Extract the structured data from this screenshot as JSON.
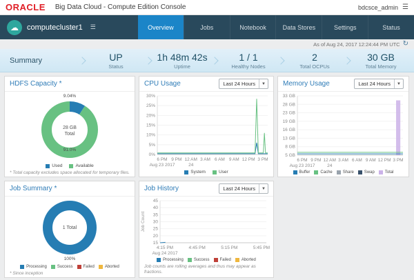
{
  "header": {
    "brand": "ORACLE",
    "title": "Big Data Cloud - Compute Edition Console",
    "user": "bdcsce_admin"
  },
  "cluster": {
    "name": "computecluster1"
  },
  "tabs": [
    {
      "label": "Overview",
      "active": true
    },
    {
      "label": "Jobs",
      "active": false
    },
    {
      "label": "Notebook",
      "active": false
    },
    {
      "label": "Data Stores",
      "active": false
    },
    {
      "label": "Settings",
      "active": false
    },
    {
      "label": "Status",
      "active": false
    }
  ],
  "asof": "As of Aug 24, 2017 12:24:44 PM UTC",
  "summary": {
    "label": "Summary",
    "metrics": [
      {
        "value": "UP",
        "label": "Status"
      },
      {
        "value": "1h 48m 42s",
        "label": "Uptime"
      },
      {
        "value": "1 / 1",
        "label": "Healthy Nodes"
      },
      {
        "value": "2",
        "label": "Total OCPUs"
      },
      {
        "value": "30 GB",
        "label": "Total Memory"
      }
    ]
  },
  "cards": {
    "hdfs": {
      "title": "HDFS Capacity *",
      "donut": {
        "slices": [
          {
            "name": "Used",
            "pct": 9.04,
            "color": "#267db3"
          },
          {
            "name": "Available",
            "pct": 90.96,
            "color": "#68c182"
          }
        ],
        "label_top": "9.04%",
        "label_bottom": "91.0%",
        "center_line1": "28 GB",
        "center_line2": "Total"
      },
      "legend": [
        {
          "label": "Used",
          "color": "#267db3"
        },
        {
          "label": "Available",
          "color": "#68c182"
        }
      ],
      "footnote": "* Total capacity excludes space allocated for temporary files."
    },
    "cpu": {
      "title": "CPU Usage",
      "range": "Last 24 Hours",
      "chart": {
        "type": "line",
        "ymax": 30,
        "yticks": [
          "30%",
          "25%",
          "20%",
          "15%",
          "10%",
          "5%",
          "0%"
        ],
        "xticks": [
          "6 PM",
          "9 PM",
          "12 AM",
          "3 AM",
          "6 AM",
          "9 AM",
          "12 PM",
          "3 PM"
        ],
        "xsub": [
          {
            "text": "Aug 23 2017",
            "at": 0
          },
          {
            "text": "24",
            "at": 2
          }
        ],
        "series": [
          {
            "name": "System",
            "color": "#267db3",
            "points": [
              [
                0,
                0.4
              ],
              [
                0.885,
                0.4
              ],
              [
                0.9,
                6
              ],
              [
                0.915,
                0.4
              ],
              [
                1,
                0.4
              ]
            ]
          },
          {
            "name": "User",
            "color": "#68c182",
            "points": [
              [
                0,
                0.8
              ],
              [
                0.885,
                0.8
              ],
              [
                0.9,
                28.5
              ],
              [
                0.915,
                0.8
              ],
              [
                0.96,
                0.8
              ],
              [
                0.97,
                11
              ],
              [
                0.98,
                0.8
              ],
              [
                1,
                0.8
              ]
            ]
          }
        ]
      },
      "legend": [
        {
          "label": "System",
          "color": "#267db3"
        },
        {
          "label": "User",
          "color": "#68c182"
        }
      ]
    },
    "memory": {
      "title": "Memory Usage",
      "range": "Last 24 Hours",
      "chart": {
        "type": "line",
        "ymax": 33,
        "yticks": [
          "33 GB",
          "28 GB",
          "23 GB",
          "19 GB",
          "16 GB",
          "13 GB",
          "8 GB",
          "5 GB"
        ],
        "xticks": [
          "6 PM",
          "9 PM",
          "12 AM",
          "3 AM",
          "6 AM",
          "9 AM",
          "12 PM",
          "3 PM"
        ],
        "xsub": [
          {
            "text": "Aug 23 2017",
            "at": 0
          },
          {
            "text": "24",
            "at": 2
          }
        ],
        "bars": [
          {
            "name": "Total",
            "color": "#cbb2e8",
            "fx": 0.955,
            "fw": 0.04,
            "v": 30.5
          }
        ],
        "series": [
          {
            "name": "Cache",
            "color": "#68c182",
            "points": [
              [
                0,
                1.6
              ],
              [
                1,
                1.6
              ]
            ]
          },
          {
            "name": "Buffer",
            "color": "#267db3",
            "points": [
              [
                0,
                0.7
              ],
              [
                1,
                0.7
              ]
            ]
          }
        ]
      },
      "legend": [
        {
          "label": "Buffer",
          "color": "#267db3"
        },
        {
          "label": "Cache",
          "color": "#68c182"
        },
        {
          "label": "Share",
          "color": "#99a3ad"
        },
        {
          "label": "Swap",
          "color": "#39516b"
        },
        {
          "label": "Total",
          "color": "#cbb2e8"
        }
      ]
    },
    "job_summary": {
      "title": "Job Summary *",
      "donut": {
        "slices": [
          {
            "name": "Processing",
            "pct": 100,
            "color": "#267db3"
          }
        ],
        "label_bottom": "100%",
        "center_line1": "1 Total",
        "center_line2": ""
      },
      "legend": [
        {
          "label": "Processing",
          "color": "#267db3"
        },
        {
          "label": "Success",
          "color": "#68c182"
        },
        {
          "label": "Failed",
          "color": "#bf4038"
        },
        {
          "label": "Aborted",
          "color": "#efb73e"
        }
      ],
      "footnote": "* Since inception"
    },
    "job_history": {
      "title": "Job History",
      "range": "Last 24 Hours",
      "chart": {
        "type": "line",
        "ymin": 15,
        "ymax": 45,
        "ylabel": "Job Count",
        "yticks": [
          "45",
          "40",
          "35",
          "30",
          "25",
          "20",
          "15"
        ],
        "xticks": [
          "4:15 PM",
          "4:45 PM",
          "5:15 PM",
          "5:45 PM"
        ],
        "xsub": [
          {
            "text": "Aug 24 2017",
            "at": 0
          }
        ],
        "series": [
          {
            "name": "Processing",
            "color": "#267db3",
            "points": [
              [
                0,
                15
              ],
              [
                0.05,
                15.3
              ]
            ]
          }
        ]
      },
      "legend": [
        {
          "label": "Processing",
          "color": "#267db3"
        },
        {
          "label": "Success",
          "color": "#68c182"
        },
        {
          "label": "Failed",
          "color": "#bf4038"
        },
        {
          "label": "Aborted",
          "color": "#efb73e"
        }
      ],
      "footnote": "Job counts are rolling averages and thus may appear as fractions."
    }
  }
}
